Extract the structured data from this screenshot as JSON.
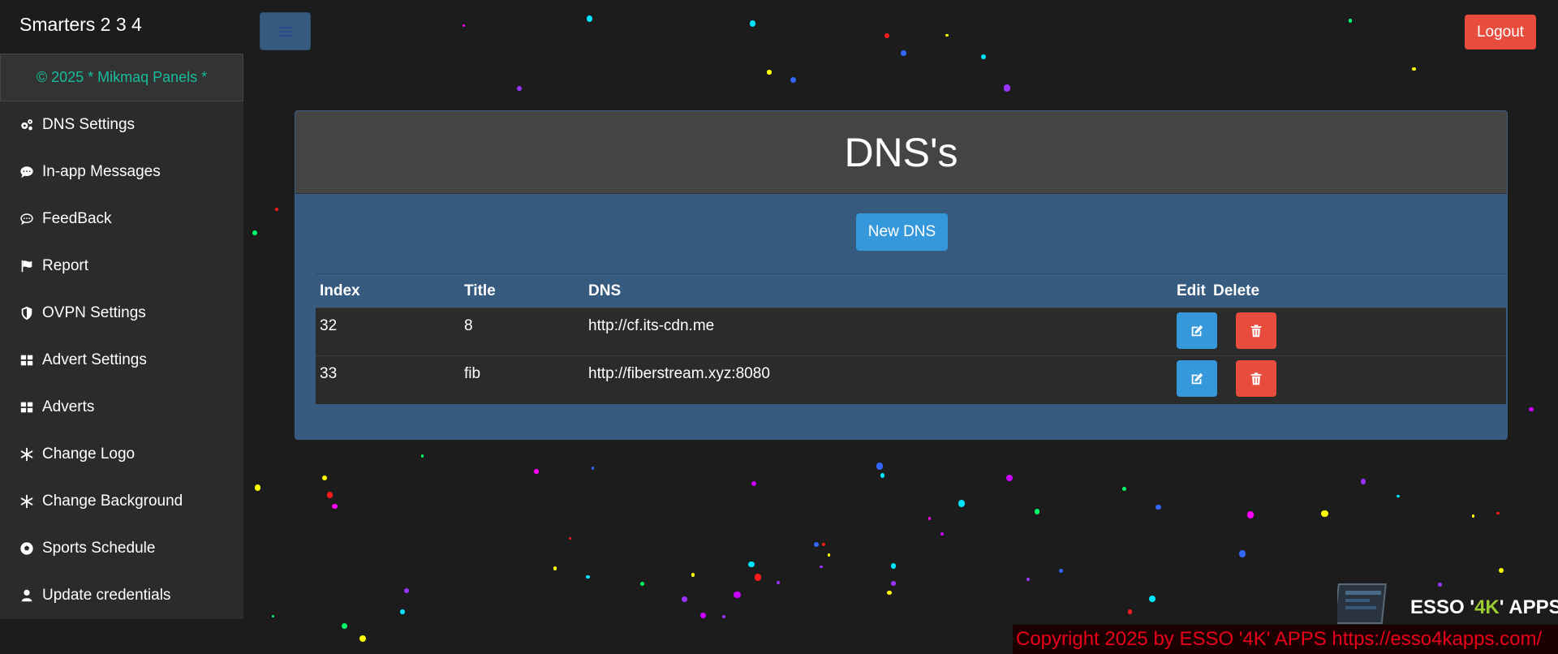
{
  "brand": "Smarters 2 3 4",
  "sidebar": {
    "copyright": "©  2025 *  Mikmaq Panels  *",
    "items": [
      {
        "label": "DNS Settings",
        "icon": "gears-icon"
      },
      {
        "label": "In-app Messages",
        "icon": "comment-icon"
      },
      {
        "label": "FeedBack",
        "icon": "comment-dots-icon"
      },
      {
        "label": "Report",
        "icon": "flag-icon"
      },
      {
        "label": "OVPN Settings",
        "icon": "shield-icon"
      },
      {
        "label": "Advert Settings",
        "icon": "th-large-icon"
      },
      {
        "label": "Adverts",
        "icon": "th-large-icon"
      },
      {
        "label": "Change Logo",
        "icon": "snowflake-icon"
      },
      {
        "label": "Change Background",
        "icon": "snowflake-icon"
      },
      {
        "label": "Sports Schedule",
        "icon": "futbol-icon"
      },
      {
        "label": "Update credentials",
        "icon": "user-icon"
      }
    ]
  },
  "header": {
    "logout_label": "Logout"
  },
  "panel": {
    "title": "DNS's",
    "new_button": "New DNS",
    "columns": [
      "Index",
      "Title",
      "DNS",
      "Edit",
      "Delete"
    ],
    "rows": [
      {
        "index": "32",
        "title": "8",
        "dns": "http://cf.its-cdn.me"
      },
      {
        "index": "33",
        "title": "fib",
        "dns": "http://fiberstream.xyz:8080"
      }
    ]
  },
  "footer": {
    "logo_text_left": "ESSO '",
    "logo_text_accent": "4K",
    "logo_text_right": "' APPS",
    "copyright": "Copyright 2025  by ESSO '4K' APPS https://esso4kapps.com/"
  },
  "colors": {
    "accent_green": "#18bc9c",
    "primary": "#3498db",
    "danger": "#e74c3c",
    "panel_blue": "#375a7f"
  }
}
